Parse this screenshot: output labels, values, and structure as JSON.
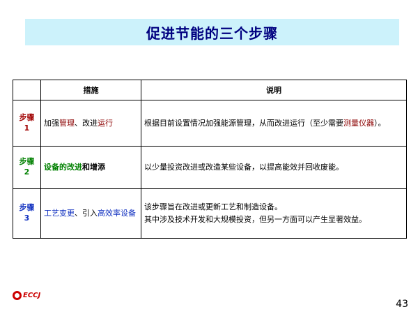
{
  "title": "促进节能的三个步骤",
  "table": {
    "headers": [
      "",
      "措施",
      "说明"
    ],
    "rows": [
      {
        "step": [
          "步骤",
          "1"
        ],
        "step_color": "#a00000",
        "measure": [
          {
            "text": "加强",
            "style": "plain"
          },
          {
            "text": "管理",
            "style": "maroon"
          },
          {
            "text": "、改进",
            "style": "plain"
          },
          {
            "text": "运行",
            "style": "maroon"
          }
        ],
        "desc": [
          {
            "text": "根据目前设置情况加强能源管理，从而改进运行（至少需要",
            "style": "plain"
          },
          {
            "text": "测量仪器",
            "style": "maroon"
          },
          {
            "text": "）。",
            "style": "plain"
          }
        ]
      },
      {
        "step": [
          "步骤",
          "2"
        ],
        "step_color": "#008000",
        "measure": [
          {
            "text": "设备的改进",
            "style": "green"
          },
          {
            "text": "和增添",
            "style": "plain-bold"
          }
        ],
        "desc": [
          {
            "text": "以少量投资改进或改造某些设备，以提高能效并回收废能。",
            "style": "plain"
          }
        ]
      },
      {
        "step": [
          "步骤",
          "3"
        ],
        "step_color": "#1030c0",
        "measure": [
          {
            "text": "工艺变更",
            "style": "blue"
          },
          {
            "text": "、引入",
            "style": "plain"
          },
          {
            "text": "高效率设备",
            "style": "blue"
          }
        ],
        "desc": [
          {
            "text": "该步骤旨在改进或更新工艺和制造设备。",
            "style": "plain"
          },
          {
            "text": "\n",
            "style": "break"
          },
          {
            "text": "其中涉及技术开发和大规模投资，但另一方面可以产生显著效益。",
            "style": "plain"
          }
        ]
      }
    ]
  },
  "footer": {
    "logo_text": "ECCJ",
    "page_number": "43"
  },
  "colors": {
    "title_band": "#ccf2fb",
    "title_text": "#000080",
    "logo": "#cc0000"
  }
}
